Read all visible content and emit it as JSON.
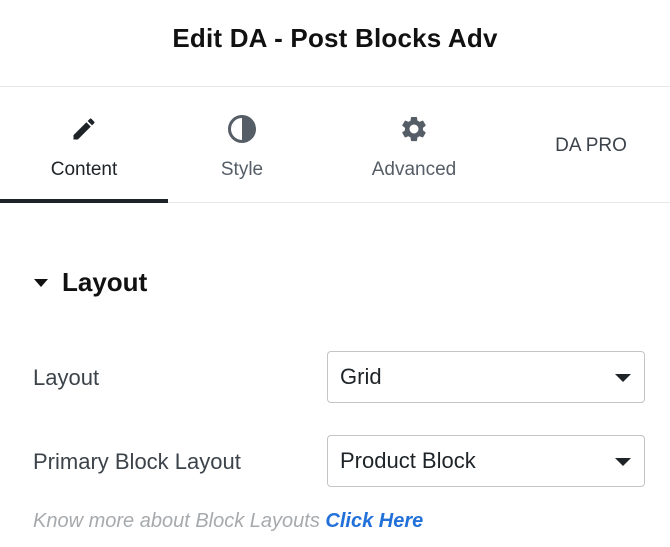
{
  "header": {
    "title": "Edit DA - Post Blocks Adv"
  },
  "tabs": [
    {
      "label": "Content",
      "icon": "pencil-icon",
      "active": true
    },
    {
      "label": "Style",
      "icon": "half-circle-contrast-icon",
      "active": false
    },
    {
      "label": "Advanced",
      "icon": "gear-icon",
      "active": false
    },
    {
      "label": "DA PRO",
      "icon": "",
      "active": false
    }
  ],
  "section": {
    "title": "Layout",
    "expanded": true
  },
  "controls": {
    "layout": {
      "label": "Layout",
      "value": "Grid"
    },
    "primary_block_layout": {
      "label": "Primary Block Layout",
      "value": "Product Block"
    }
  },
  "help": {
    "text": "Know more about Block Layouts",
    "link_label": "Click Here"
  },
  "colors": {
    "text": "#1d2327",
    "muted": "#a7aaad",
    "link": "#2271d9",
    "border": "#c3c4c7"
  }
}
